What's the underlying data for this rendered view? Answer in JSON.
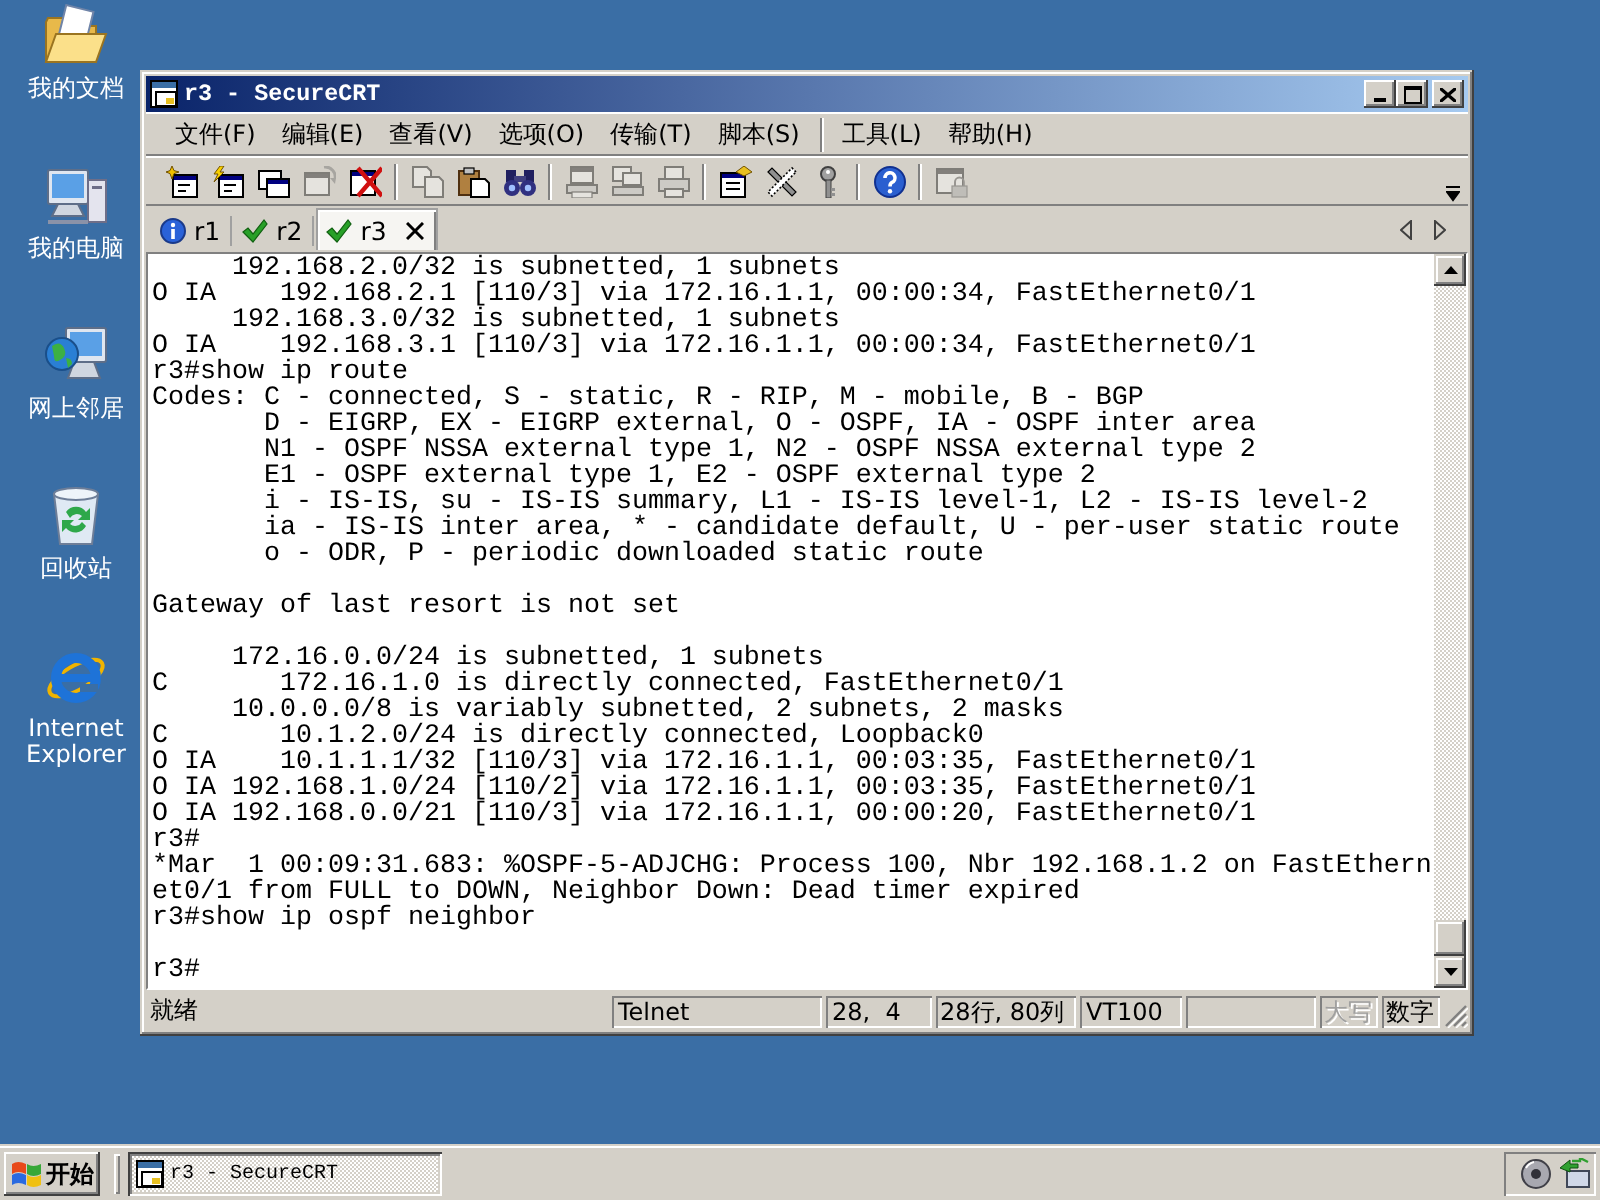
{
  "desktop_icons": [
    {
      "label": "我的文档",
      "kind": "folder"
    },
    {
      "label": "我的电脑",
      "kind": "computer"
    },
    {
      "label": "网上邻居",
      "kind": "network"
    },
    {
      "label": "回收站",
      "kind": "recycle"
    },
    {
      "label": "Internet Explorer",
      "kind": "browser"
    }
  ],
  "window": {
    "title": "r3 - SecureCRT"
  },
  "menu": [
    [
      "文件(F)",
      "编辑(E)",
      "查看(V)",
      "选项(O)",
      "传输(T)",
      "脚本(S)"
    ],
    [
      "工具(L)",
      "帮助(H)"
    ]
  ],
  "toolbar": [
    [
      {
        "kind": "sparkle",
        "disabled": false
      },
      {
        "kind": "lightning",
        "disabled": false
      },
      {
        "kind": "tabs",
        "disabled": false
      },
      {
        "kind": "reconnect",
        "disabled": true
      },
      {
        "kind": "cross",
        "disabled": false
      }
    ],
    [
      {
        "kind": "copy",
        "disabled": true
      },
      {
        "kind": "paste",
        "disabled": false
      },
      {
        "kind": "binoculars",
        "disabled": false
      }
    ],
    [
      {
        "kind": "tray",
        "disabled": true
      },
      {
        "kind": "trays",
        "disabled": true
      },
      {
        "kind": "printer",
        "disabled": true
      }
    ],
    [
      {
        "kind": "sheet",
        "disabled": false
      },
      {
        "kind": "tools",
        "disabled": false
      },
      {
        "kind": "key",
        "disabled": false
      }
    ],
    [
      {
        "kind": "help",
        "disabled": false
      }
    ],
    [
      {
        "kind": "lock",
        "disabled": true
      }
    ]
  ],
  "tabs": [
    {
      "label": "r1",
      "kind": "info",
      "selected": false
    },
    {
      "label": "r2",
      "kind": "connected",
      "selected": false
    },
    {
      "label": "r3",
      "kind": "connected",
      "selected": true
    }
  ],
  "terminal": {
    "blocks": [
      [
        "     192.168.2.0/32 is subnetted, 1 subnets",
        "O IA    192.168.2.1 [110/3] via 172.16.1.1, 00:00:34, FastEthernet0/1",
        "     192.168.3.0/32 is subnetted, 1 subnets",
        "O IA    192.168.3.1 [110/3] via 172.16.1.1, 00:00:34, FastEthernet0/1",
        "r3#show ip route",
        "Codes: C - connected, S - static, R - RIP, M - mobile, B - BGP",
        "       D - EIGRP, EX - EIGRP external, O - OSPF, IA - OSPF inter area",
        "       N1 - OSPF NSSA external type 1, N2 - OSPF NSSA external type 2",
        "       E1 - OSPF external type 1, E2 - OSPF external type 2",
        "       i - IS-IS, su - IS-IS summary, L1 - IS-IS level-1, L2 - IS-IS level-2",
        "       ia - IS-IS inter area, * - candidate default, U - per-user static route",
        "       o - ODR, P - periodic downloaded static route"
      ],
      [
        "Gateway of last resort is not set"
      ],
      [
        "     172.16.0.0/24 is subnetted, 1 subnets",
        "C       172.16.1.0 is directly connected, FastEthernet0/1",
        "     10.0.0.0/8 is variably subnetted, 2 subnets, 2 masks",
        "C       10.1.2.0/24 is directly connected, Loopback0",
        "O IA    10.1.1.1/32 [110/3] via 172.16.1.1, 00:03:35, FastEthernet0/1",
        "O IA 192.168.1.0/24 [110/2] via 172.16.1.1, 00:03:35, FastEthernet0/1",
        "O IA 192.168.0.0/21 [110/3] via 172.16.1.1, 00:00:20, FastEthernet0/1",
        "r3#",
        "*Mar  1 00:09:31.683: %OSPF-5-ADJCHG: Process 100, Nbr 192.168.1.2 on FastEthern",
        "et0/1 from FULL to DOWN, Neighbor Down: Dead timer expired",
        "r3#show ip ospf neighbor"
      ],
      [
        "r3#"
      ]
    ]
  },
  "status_bar": {
    "message": "就绪",
    "panes": [
      "Telnet",
      "28,  4",
      "28行, 80列",
      "VT100"
    ],
    "indicators": [
      {
        "label": "大写",
        "on": false
      },
      {
        "label": "数字",
        "on": true
      }
    ]
  },
  "taskbar": {
    "start": "开始",
    "tasks": [
      {
        "label": "r3 - SecureCRT",
        "selected": true
      }
    ]
  }
}
